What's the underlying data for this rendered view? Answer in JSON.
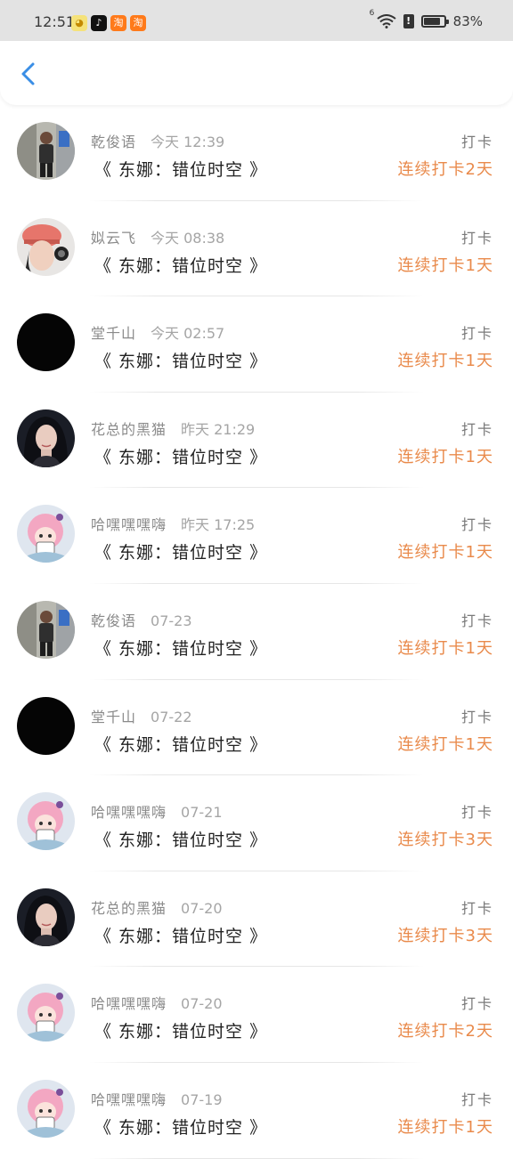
{
  "status_bar": {
    "time": "12:51",
    "battery": "83%",
    "battery_level": 0.83,
    "network": "6",
    "icons": [
      "qq-browser-icon",
      "tiktok-icon",
      "taobao-icon",
      "taobao-icon"
    ]
  },
  "header": {
    "back_icon": "chevron-left-icon",
    "accent_color": "#3a8ee6"
  },
  "colors": {
    "streak": "#e98a4b",
    "name": "#8a8a8a",
    "title": "#222222"
  },
  "rows": [
    {
      "avatar": "photo-street",
      "name": "乾俊语",
      "time": "今天 12:39",
      "title": "《 东娜：错位时空 》",
      "tag": "打卡",
      "streak": "连续打卡2天"
    },
    {
      "avatar": "photo-cap",
      "name": "姒云飞",
      "time": "今天 08:38",
      "title": "《 东娜：错位时空 》",
      "tag": "打卡",
      "streak": "连续打卡1天"
    },
    {
      "avatar": "black",
      "name": "堂千山",
      "time": "今天 02:57",
      "title": "《 东娜：错位时空 》",
      "tag": "打卡",
      "streak": "连续打卡1天"
    },
    {
      "avatar": "photo-woman",
      "name": "花总的黑猫",
      "time": "昨天 21:29",
      "title": "《 东娜：错位时空 》",
      "tag": "打卡",
      "streak": "连续打卡1天"
    },
    {
      "avatar": "anime-pink",
      "name": "哈嘿嘿嘿嗨",
      "time": "昨天 17:25",
      "title": "《 东娜：错位时空 》",
      "tag": "打卡",
      "streak": "连续打卡1天"
    },
    {
      "avatar": "photo-street",
      "name": "乾俊语",
      "time": "07-23",
      "title": "《 东娜：错位时空 》",
      "tag": "打卡",
      "streak": "连续打卡1天"
    },
    {
      "avatar": "black",
      "name": "堂千山",
      "time": "07-22",
      "title": "《 东娜：错位时空 》",
      "tag": "打卡",
      "streak": "连续打卡1天"
    },
    {
      "avatar": "anime-pink",
      "name": "哈嘿嘿嘿嗨",
      "time": "07-21",
      "title": "《 东娜：错位时空 》",
      "tag": "打卡",
      "streak": "连续打卡3天"
    },
    {
      "avatar": "photo-woman",
      "name": "花总的黑猫",
      "time": "07-20",
      "title": "《 东娜：错位时空 》",
      "tag": "打卡",
      "streak": "连续打卡3天"
    },
    {
      "avatar": "anime-pink",
      "name": "哈嘿嘿嘿嗨",
      "time": "07-20",
      "title": "《 东娜：错位时空 》",
      "tag": "打卡",
      "streak": "连续打卡2天"
    },
    {
      "avatar": "anime-pink",
      "name": "哈嘿嘿嘿嗨",
      "time": "07-19",
      "title": "《 东娜：错位时空 》",
      "tag": "打卡",
      "streak": "连续打卡1天"
    }
  ]
}
